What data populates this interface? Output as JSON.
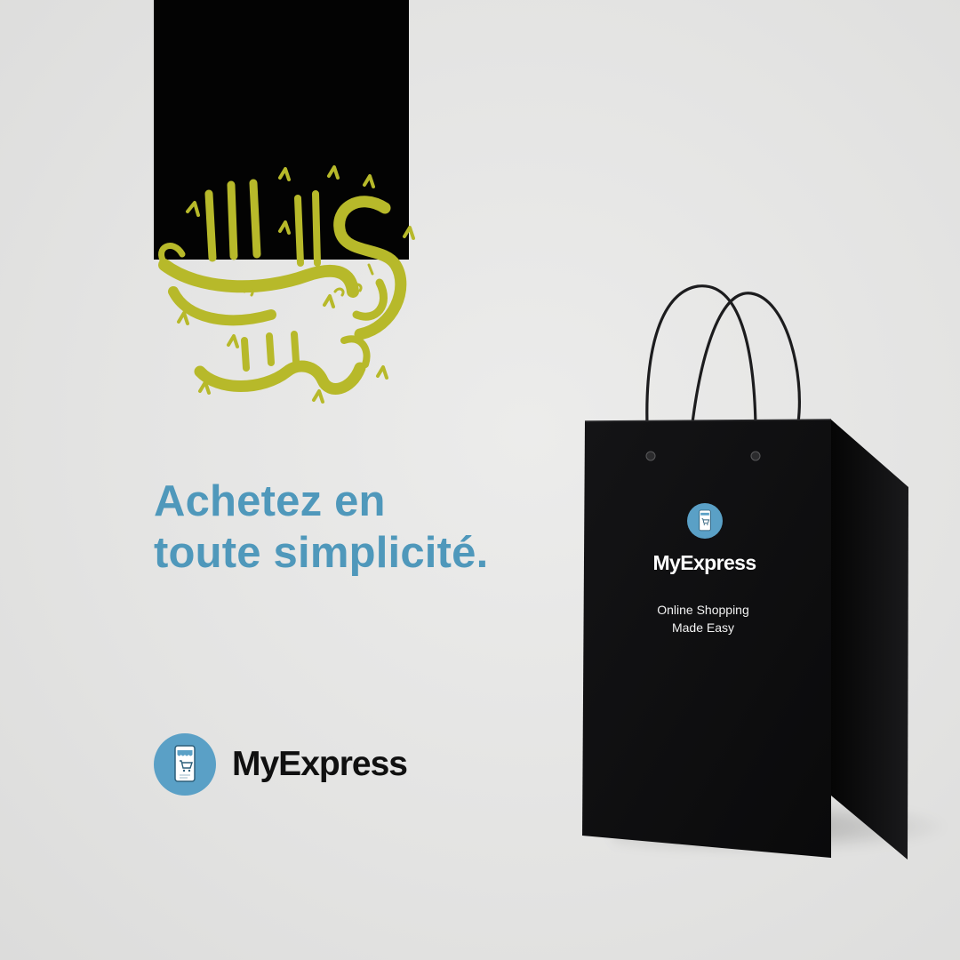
{
  "greeting": {
    "calligraphy_text": "عيد مبارك",
    "calligraphy_color": "#b7b92a",
    "banner_color": "#030303"
  },
  "headline": {
    "line1": "Achetez en",
    "line2": "toute simplicité.",
    "color": "#4f98bb"
  },
  "brand": {
    "name": "MyExpress",
    "logo_icon": "shopping-cart-phone-icon",
    "logo_color": "#5aa0c6"
  },
  "bag": {
    "color": "#0b0b0c",
    "brand_name": "MyExpress",
    "tagline_line1": "Online Shopping",
    "tagline_line2": "Made Easy",
    "logo_icon": "shopping-cart-phone-icon"
  }
}
